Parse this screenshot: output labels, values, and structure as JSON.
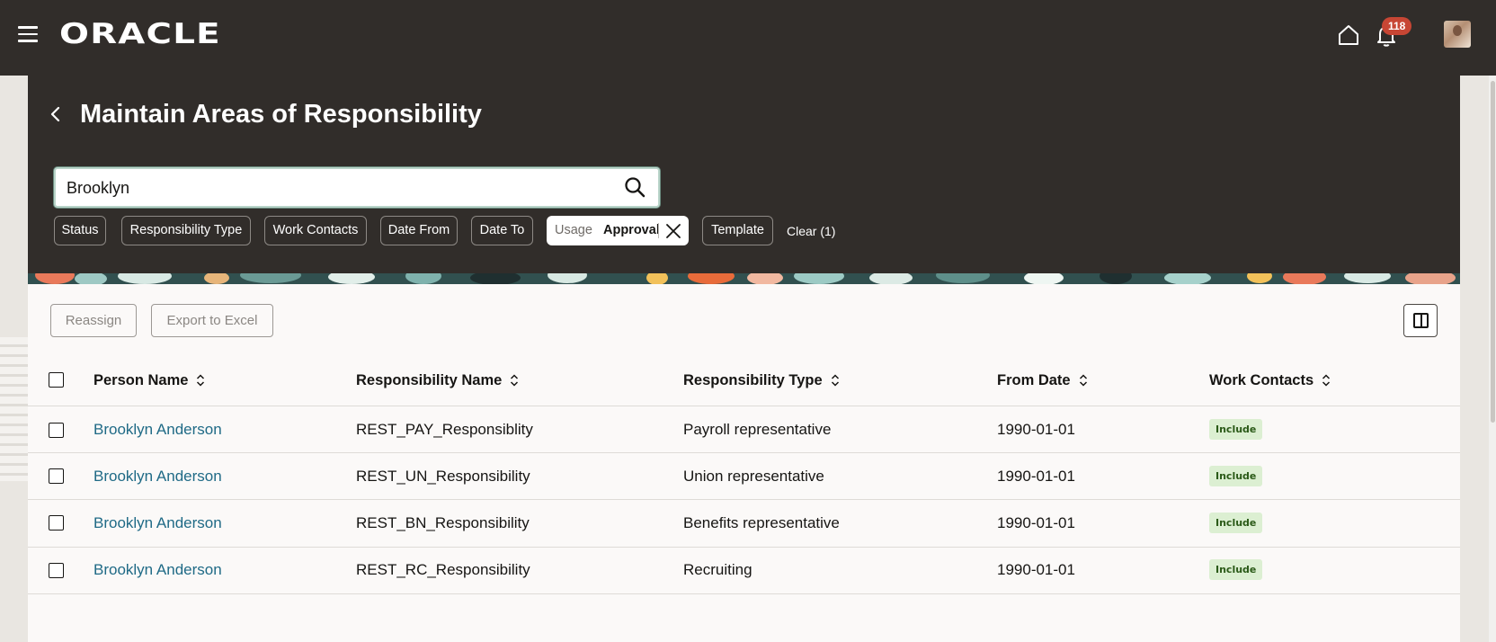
{
  "app": {
    "logo": "ORACLE",
    "notification_count": "118"
  },
  "page": {
    "title": "Maintain Areas of Responsibility"
  },
  "search": {
    "value": "Brooklyn"
  },
  "filters": {
    "chips": [
      "Status",
      "Responsibility Type",
      "Work Contacts",
      "Date From",
      "Date To"
    ],
    "active_chip": {
      "key": "Usage",
      "value": "Approval"
    },
    "template": "Template",
    "clear": "Clear (1)"
  },
  "toolbar": {
    "reassign": "Reassign",
    "export": "Export to Excel"
  },
  "table": {
    "columns": [
      "Person Name",
      "Responsibility Name",
      "Responsibility Type",
      "From Date",
      "Work Contacts"
    ],
    "rows": [
      {
        "person": "Brooklyn Anderson",
        "responsibility": "REST_PAY_Responsiblity",
        "type": "Payroll representative",
        "from": "1990-01-01",
        "contacts": "Include"
      },
      {
        "person": "Brooklyn Anderson",
        "responsibility": "REST_UN_Responsibility",
        "type": "Union representative",
        "from": "1990-01-01",
        "contacts": "Include"
      },
      {
        "person": "Brooklyn Anderson",
        "responsibility": "REST_BN_Responsibility",
        "type": "Benefits representative",
        "from": "1990-01-01",
        "contacts": "Include"
      },
      {
        "person": "Brooklyn Anderson",
        "responsibility": "REST_RC_Responsibility",
        "type": "Recruiting",
        "from": "1990-01-01",
        "contacts": "Include"
      }
    ]
  },
  "colors": {
    "header_bg": "#312d2a",
    "link": "#1f6a86",
    "badge": "#c74634",
    "tag_bg": "#dcefd2",
    "tag_text": "#2b5a18"
  }
}
